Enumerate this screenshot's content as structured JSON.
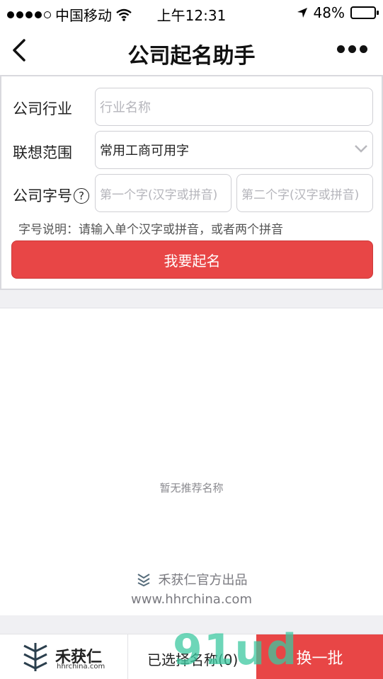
{
  "status_bar": {
    "carrier": "中国移动",
    "time": "上午12:31",
    "battery_percent": "48%",
    "battery_level": 0.48
  },
  "nav": {
    "title": "公司起名助手"
  },
  "form": {
    "industry_label": "公司行业",
    "industry_placeholder": "行业名称",
    "scope_label": "联想范围",
    "scope_value": "常用工商可用字",
    "name_label": "公司字号",
    "help_glyph": "?",
    "char1_placeholder": "第一个字(汉字或拼音)",
    "char2_placeholder": "第二个字(汉字或拼音)",
    "hint": "字号说明：请输入单个汉字或拼音，或者两个拼音",
    "submit_label": "我要起名"
  },
  "results": {
    "empty_text": "暂无推荐名称",
    "credit": "禾获仁官方出品",
    "url": "www.hhrchina.com"
  },
  "bottom_bar": {
    "logo_name": "禾获仁",
    "logo_url": "hhrchina.com",
    "selected_count": "已选择名称(0)",
    "refresh_label": "换一批"
  },
  "watermark": "91ud",
  "colors": {
    "accent_red": "#e84646",
    "battery_yellow": "#f5c400"
  }
}
